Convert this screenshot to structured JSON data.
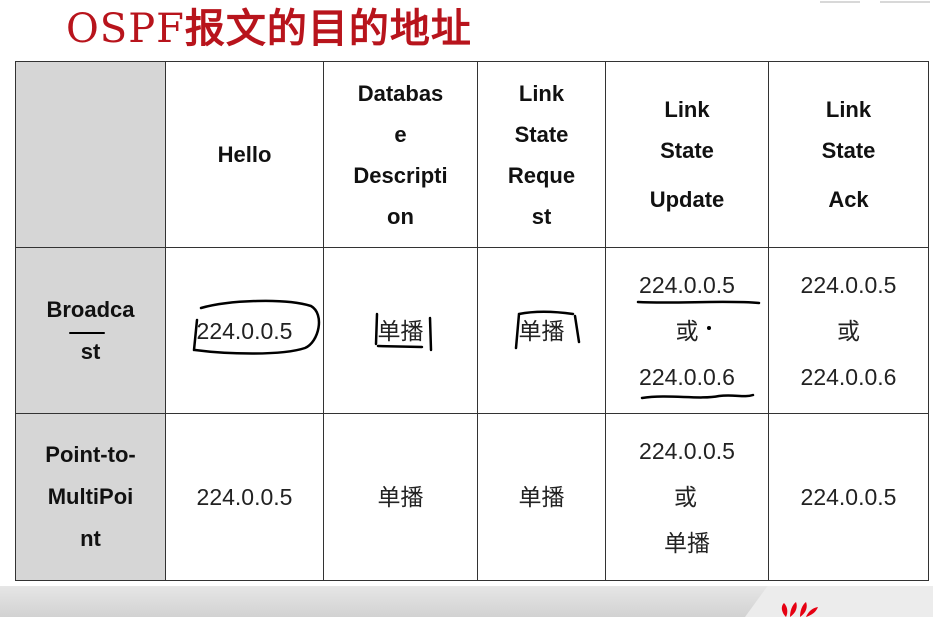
{
  "title": {
    "prefix": "OSPF",
    "suffix": "报文的目的地址"
  },
  "table": {
    "columns": [
      [
        "Hello"
      ],
      [
        "Databas",
        "e",
        "Descripti",
        "on"
      ],
      [
        "Link",
        "State",
        "Reque",
        "st"
      ],
      [
        "Link",
        "State",
        "Update"
      ],
      [
        "Link",
        "State",
        "Ack"
      ]
    ],
    "rows": [
      {
        "header": [
          "Broadca",
          "st"
        ],
        "cells": [
          [
            "224.0.0.5"
          ],
          [
            "单播"
          ],
          [
            "单播"
          ],
          [
            "224.0.0.5",
            "或",
            "224.0.0.6"
          ],
          [
            "224.0.0.5",
            "或",
            "224.0.0.6"
          ]
        ]
      },
      {
        "header": [
          "Point-to-",
          "MultiPoi",
          "nt"
        ],
        "cells": [
          [
            "224.0.0.5"
          ],
          [
            "单播"
          ],
          [
            "单播"
          ],
          [
            "224.0.0.5",
            "或",
            "单播"
          ],
          [
            "224.0.0.5"
          ]
        ]
      }
    ]
  },
  "colors": {
    "title": "#b8141c",
    "header_bg": "#d6d6d6",
    "annotation": "#000000",
    "logo": "#e60012"
  },
  "icons": {
    "brand_logo": "huawei-logo-icon"
  }
}
